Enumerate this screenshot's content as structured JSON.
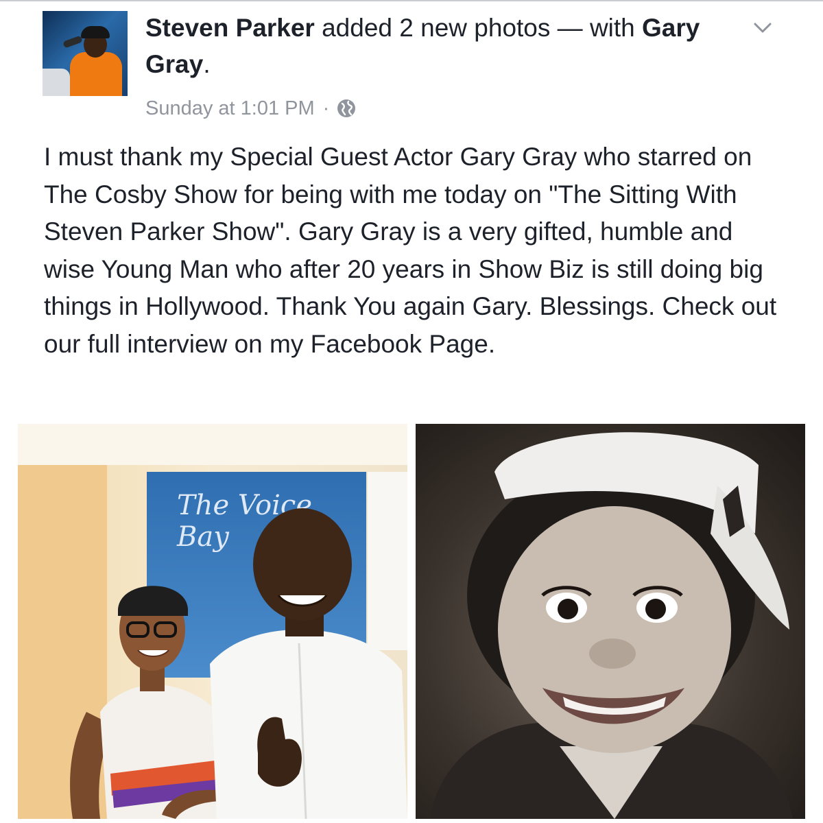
{
  "post": {
    "actor_name": "Steven Parker",
    "action_text": " added 2 new photos — with ",
    "tagged_name": "Gary Gray",
    "tagged_suffix": ".",
    "timestamp": "Sunday at 1:01 PM",
    "separator": "·",
    "privacy_icon": "globe-icon",
    "menu_icon": "chevron-down-icon",
    "body": "I must thank my Special Guest Actor Gary Gray who starred on The Cosby Show for being with me today on \"The Sitting With Steven Parker Show\". Gary Gray is a very gifted, humble and wise Young Man who after 20 years in Show Biz is still doing big things in Hollywood. Thank You again Gary. Blessings. Check out our full interview on my Facebook Page.",
    "photo_count": 2
  },
  "photos": {
    "left_banner_text": "The Voice Bay"
  },
  "colors": {
    "text_primary": "#1d2129",
    "text_meta": "#90949c",
    "divider": "#c9ccd1"
  }
}
